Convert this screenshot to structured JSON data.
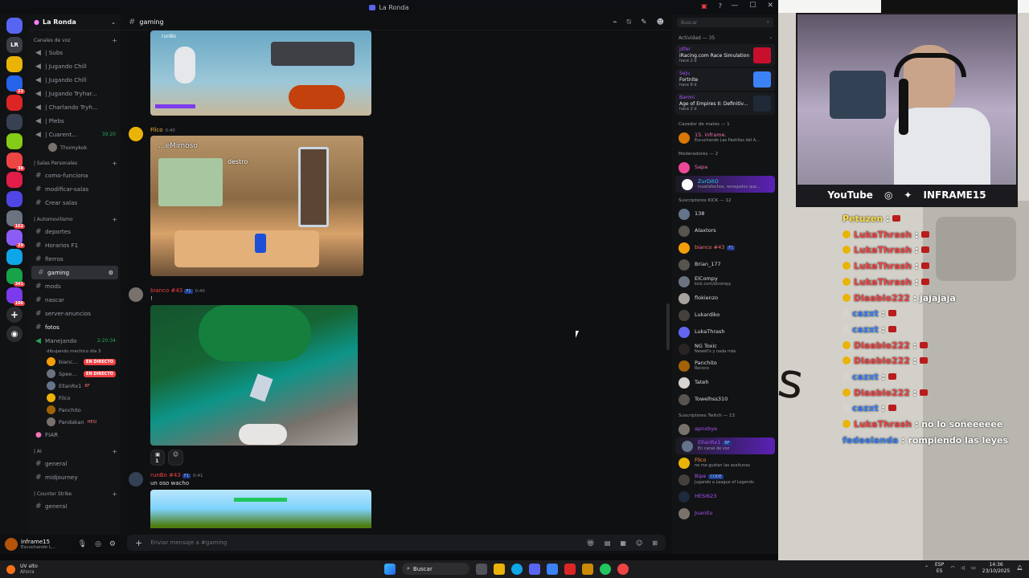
{
  "window": {
    "title": "La Ronda"
  },
  "servers": [
    {
      "label": "",
      "color": "#5865f2"
    },
    {
      "label": "LR",
      "color": "#3b3f45"
    },
    {
      "label": "",
      "color": "#eab308",
      "badge": ""
    },
    {
      "label": "",
      "color": "#2563eb",
      "badge": "23"
    },
    {
      "label": "",
      "color": "#dc2626"
    },
    {
      "label": "",
      "color": "#374151"
    },
    {
      "label": "",
      "color": "#84cc16"
    },
    {
      "label": "",
      "color": "#ef4444",
      "badge": "38"
    },
    {
      "label": "",
      "color": "#e11d48"
    },
    {
      "label": "",
      "color": "#4f46e5"
    },
    {
      "label": "",
      "color": "#6b7280",
      "badge": "162"
    },
    {
      "label": "",
      "color": "#8b5cf6",
      "badge": "29"
    },
    {
      "label": "",
      "color": "#0ea5e9"
    },
    {
      "label": "",
      "color": "#16a34a",
      "badge": "341"
    },
    {
      "label": "",
      "color": "#7c3aed",
      "badge": "106"
    }
  ],
  "guild": {
    "name": "La Ronda"
  },
  "sidebar": {
    "voice_category": "Canales de voz",
    "voice_channels": [
      {
        "name": "| Subs"
      },
      {
        "name": "| Jugando Chill"
      },
      {
        "name": "| Jugando Chill"
      },
      {
        "name": "| Jugando Tryhar..."
      },
      {
        "name": "| Charlando Tryh..."
      },
      {
        "name": "| Plebs"
      },
      {
        "name": "| Cuarent...",
        "duration": "39:20"
      }
    ],
    "voice_user": "Thomykok",
    "cat_personal": "| Salas Personales",
    "personal": [
      "como-funciona",
      "modificar-salas",
      "Crear salas"
    ],
    "cat_auto": "| Automovilismo",
    "auto": [
      "deportes",
      "Horarios F1",
      "fierros",
      "gaming",
      "mods",
      "nascar",
      "server-anuncios",
      "fotos"
    ],
    "driving": {
      "name": "Manejando",
      "duration": "2:20:34",
      "status": "dibujando mechico día 3"
    },
    "driving_users": [
      {
        "name": "bianc...",
        "live": "EN DIRECTO",
        "color": "#f59e0b"
      },
      {
        "name": "Spee...",
        "live": "EN DIRECTO",
        "color": "#6b7280"
      },
      {
        "name": "EllanRx1",
        "live": "",
        "tag": "BF",
        "color": "#64748b"
      },
      {
        "name": "Filco",
        "live": "",
        "color": "#eab308"
      },
      {
        "name": "Panchito",
        "live": "",
        "color": "#a16207"
      },
      {
        "name": "Pandakan",
        "live": "",
        "tag": "HESI",
        "color": "#78716c"
      }
    ],
    "fiar": "FIAR",
    "cat_ai": "| AI",
    "ai": [
      "general",
      "midjourney"
    ],
    "cat_cs": "| Counter Strike",
    "cs": [
      "general"
    ]
  },
  "user": {
    "name": "inframe15",
    "status": "Escuchando L..."
  },
  "channel": {
    "name": "gaming"
  },
  "messages": [
    {
      "author": "runBo",
      "time": "",
      "text": "",
      "color": "#dbdee1"
    },
    {
      "author": "Filco",
      "time": "0:40",
      "text": "",
      "color": "#f0b232"
    },
    {
      "author": "bianco #43",
      "tag": "F1",
      "time": "0:40",
      "text": "!",
      "color": "#ed4245"
    },
    {
      "author": "runBo #43",
      "tag": "F1",
      "time": "0:41",
      "text": "un oso wacho",
      "color": "#ed4245"
    }
  ],
  "screens": {
    "s2_label": "destro",
    "s2_overlay": "...eMimoso"
  },
  "reaction": {
    "count": "1"
  },
  "composer": {
    "placeholder": "Enviar mensaje a #gaming"
  },
  "members": {
    "search": "Buscar",
    "activity_head": "Actividad — 35",
    "activities": [
      {
        "user": "Jdfer",
        "game": "iRacing.com Race Simulation",
        "time": "hace 2 d",
        "color": "#c8102e"
      },
      {
        "user": "Seju",
        "game": "Fortnite",
        "time": "hace 8 d",
        "color": "#3b82f6"
      },
      {
        "user": "Baroni",
        "game": "Age of Empires II: Definitiv...",
        "time": "hace 2 d",
        "color": "#1f2937"
      }
    ],
    "cat_cazador": "Cazador de mates — 1",
    "cazador": [
      {
        "name": "15. inframe.",
        "status": "Escuchando Las Pastillas del A...",
        "color": "#d97706",
        "name_color": "#f472b6"
      }
    ],
    "cat_mods": "Moderadores — 2",
    "mods": [
      {
        "name": "Sapa",
        "status": "",
        "color": "#ec4899",
        "name_color": "#f472b6"
      },
      {
        "name": "ZurDitO",
        "status": "insatisfechos, renegados que...",
        "color": "#ffffff",
        "name_color": "#22d3ee",
        "hl": true
      }
    ],
    "cat_kick": "Suscriptores KICK — 12",
    "kick": [
      {
        "name": "138",
        "status": "",
        "color": "#64748b"
      },
      {
        "name": "Alaxtors",
        "status": "",
        "color": "#57534e"
      },
      {
        "name": "bianco #43",
        "status": "",
        "tag": "F1",
        "color": "#f59e0b",
        "name_color": "#f87171"
      },
      {
        "name": "Brian_177",
        "status": "",
        "color": "#57534e"
      },
      {
        "name": "ElCompy",
        "status": "kick.com/elcompy",
        "color": "#6b7280"
      },
      {
        "name": "flokienzo",
        "status": "",
        "color": "#a8a29e"
      },
      {
        "name": "Lukardiko",
        "status": "",
        "color": "#44403c"
      },
      {
        "name": "LukaThrash",
        "status": "",
        "color": "#6366f1"
      },
      {
        "name": "NG Toxic",
        "status": "Newell's y nada más",
        "color": "#292524"
      },
      {
        "name": "Panchito",
        "status": "Rococo",
        "color": "#a16207"
      },
      {
        "name": "Tateh",
        "status": "",
        "color": "#d6d3d1"
      },
      {
        "name": "Towelhss310",
        "status": "",
        "color": "#57534e"
      }
    ],
    "cat_twitch": "Suscriptores Twitch — 13",
    "twitch": [
      {
        "name": "apnxbye",
        "status": "",
        "color": "#78716c",
        "name_color": "#a855f7"
      },
      {
        "name": "EllanRx1",
        "status": "En canal de voz",
        "tag": "BF",
        "color": "#64748b",
        "name_color": "#a855f7",
        "hl": true
      },
      {
        "name": "Filco",
        "status": "no me gustan las aceitunas",
        "color": "#eab308",
        "name_color": "#fb923c"
      },
      {
        "name": "Bipe",
        "status": "Jugando a League of Legends",
        "tag": "CODE",
        "color": "#44403c",
        "name_color": "#a855f7"
      },
      {
        "name": "HESI623",
        "status": "",
        "color": "#1e293b",
        "name_color": "#a855f7"
      },
      {
        "name": "Juanitu",
        "status": "",
        "color": "#78716c",
        "name_color": "#a855f7"
      }
    ]
  },
  "stream": {
    "socials": [
      "YouTube",
      "INFRAME15"
    ],
    "chat": [
      {
        "user": "Petuzen",
        "msg": "",
        "color": "#fde047",
        "badge": "none"
      },
      {
        "user": "LukaThrash",
        "msg": "",
        "color": "#ef4444",
        "badge": "coin"
      },
      {
        "user": "LukaThrash",
        "msg": "",
        "color": "#ef4444",
        "badge": "coin"
      },
      {
        "user": "LukaThrash",
        "msg": "",
        "color": "#ef4444",
        "badge": "coin"
      },
      {
        "user": "LukaThrash",
        "msg": "",
        "color": "#ef4444",
        "badge": "coin"
      },
      {
        "user": "Diaablo222",
        "msg": "jajajaja",
        "color": "#ef4444",
        "badge": "coin"
      },
      {
        "user": "cazxt",
        "msg": "",
        "color": "#3b82f6",
        "badge": "bar"
      },
      {
        "user": "cazxt",
        "msg": "",
        "color": "#3b82f6",
        "badge": "bar"
      },
      {
        "user": "Diaablo222",
        "msg": "",
        "color": "#ef4444",
        "badge": "coin"
      },
      {
        "user": "Diaablo222",
        "msg": "",
        "color": "#ef4444",
        "badge": "coin"
      },
      {
        "user": "cazxt",
        "msg": "",
        "color": "#3b82f6",
        "badge": "bar"
      },
      {
        "user": "Diaablo222",
        "msg": "",
        "color": "#ef4444",
        "badge": "coin"
      },
      {
        "user": "cazxt",
        "msg": "",
        "color": "#3b82f6",
        "badge": "bar"
      },
      {
        "user": "LukaThrash",
        "msg": "no lo soñeeeeee",
        "color": "#ef4444",
        "badge": "coin"
      },
      {
        "user": "fedeelanda",
        "msg": "rompiendo las leyes",
        "color": "#3b82f6",
        "badge": "none"
      }
    ]
  },
  "taskbar": {
    "weather": "UV alto",
    "weather_sub": "Ahora",
    "search": "Buscar",
    "lang": "ESP",
    "lang_sub": "ES",
    "time": "14:36",
    "date": "23/10/2025"
  }
}
